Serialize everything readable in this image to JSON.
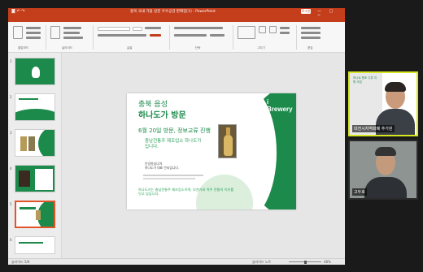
{
  "window": {
    "title": "충북 국내 가을 방문 우수공감 판매장[1] - PowerPoint",
    "account": "로그인",
    "controls": "— ▢ ✕"
  },
  "menu": [
    "파일",
    "홈",
    "삽입",
    "디자인",
    "전환",
    "애니메이션",
    "슬라이드 쇼",
    "검토",
    "보기",
    "도움말",
    "무엇을 원하시나요?"
  ],
  "menu_selected_index": 1,
  "ribbon_groups": [
    "클립보드",
    "슬라이드",
    "글꼴",
    "단락",
    "그리기",
    "편집"
  ],
  "thumb_numbers": [
    "1",
    "2",
    "3",
    "4",
    "5",
    "6"
  ],
  "slide": {
    "brand": "i Brewery",
    "region": "충북 음성",
    "title": "하나도가 방문",
    "date_line": "6월 20일 방문, 정보교류 진행",
    "intro": "충남전통주 제조업소 하나도가입니다.",
    "small_title": "안녕하십니까.",
    "small_sub": "하나도가 대표 안씨입니다.",
    "desc": "하나도가는 충남전통주 제조업소이며, 부친가와 역주 전통의 이유를 잇고 있습니다."
  },
  "status": {
    "left": "슬라이드 5/6",
    "right": "슬라이드 노트",
    "zoom": "48%"
  },
  "participants": [
    {
      "name": "대전시지역화폐 추가원"
    },
    {
      "name": "고두호"
    }
  ],
  "participant1_sign": "하나로 원조 주류 지원 사업",
  "colors": {
    "accent": "#c43e1c",
    "slide_green": "#1c8a4b",
    "speaker_border": "#d6e620"
  }
}
